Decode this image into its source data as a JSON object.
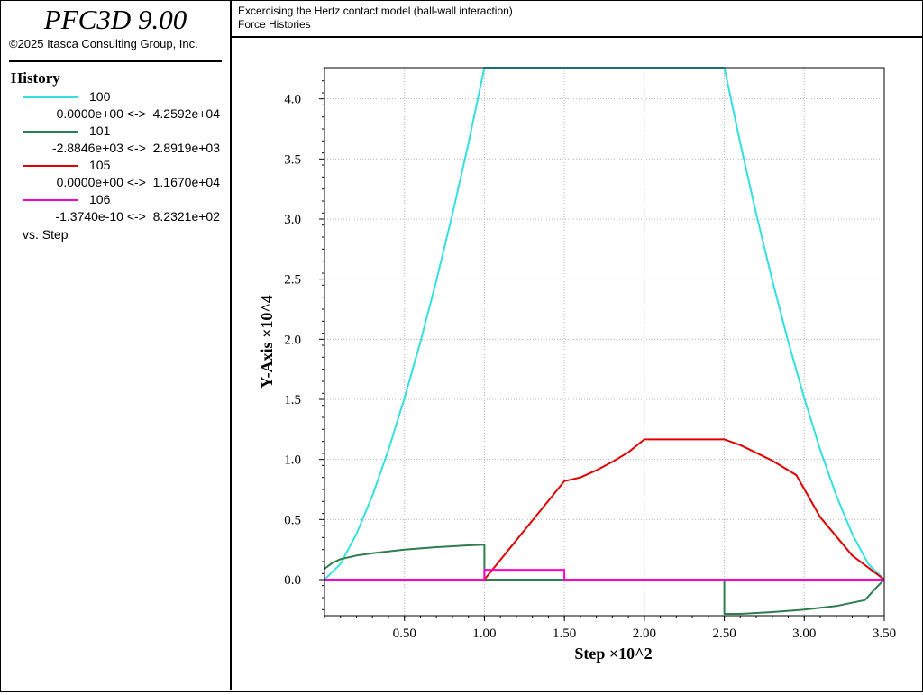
{
  "app": {
    "title": "PFC3D 9.00",
    "copyright": "©2025 Itasca Consulting Group, Inc."
  },
  "header": {
    "line1": "Excercising the Hertz contact model (ball-wall interaction)",
    "line2": "Force Histories"
  },
  "legend": {
    "heading": "History",
    "entries": [
      {
        "id": "100",
        "range": "0.0000e+00 <->  4.2592e+04",
        "color": "#33e0e0"
      },
      {
        "id": "101",
        "range": "-2.8846e+03 <->  2.8919e+03",
        "color": "#2e7d4f"
      },
      {
        "id": "105",
        "range": "0.0000e+00 <->  1.1670e+04",
        "color": "#e00000"
      },
      {
        "id": "106",
        "range": "-1.3740e-10 <->  8.2321e+02",
        "color": "#ff00c8"
      }
    ],
    "vs": "vs. Step"
  },
  "chart_data": {
    "type": "line",
    "xlabel": "Step  ×10^2",
    "ylabel": "Y-Axis  ×10^4",
    "xlim": [
      0,
      3.5
    ],
    "ylim": [
      -0.3,
      4.26
    ],
    "x_ticks": [
      "0.50",
      "1.00",
      "1.50",
      "2.00",
      "2.50",
      "3.00",
      "3.50"
    ],
    "y_ticks": [
      "0.0",
      "0.5",
      "1.0",
      "1.5",
      "2.0",
      "2.5",
      "3.0",
      "3.5",
      "4.0"
    ],
    "grid": true,
    "series": [
      {
        "name": "100",
        "color": "#33e0e0",
        "x": [
          0,
          0.1,
          0.2,
          0.3,
          0.4,
          0.5,
          0.6,
          0.7,
          0.8,
          0.9,
          1.0,
          1.5,
          2.0,
          2.5,
          2.6,
          2.7,
          2.8,
          2.9,
          3.0,
          3.1,
          3.2,
          3.3,
          3.4,
          3.5
        ],
        "y": [
          0,
          0.13,
          0.38,
          0.7,
          1.08,
          1.51,
          1.98,
          2.49,
          3.04,
          3.63,
          4.26,
          4.26,
          4.26,
          4.26,
          3.63,
          3.04,
          2.49,
          1.98,
          1.51,
          1.08,
          0.7,
          0.38,
          0.13,
          0
        ]
      },
      {
        "name": "101",
        "color": "#2e7d4f",
        "x": [
          0,
          0.05,
          0.1,
          0.2,
          0.3,
          0.5,
          0.7,
          0.9,
          1.0,
          1.0,
          1.5,
          1.5,
          2.5,
          2.5,
          2.6,
          2.8,
          3.0,
          3.2,
          3.38,
          3.44,
          3.5
        ],
        "y": [
          0.09,
          0.14,
          0.17,
          0.2,
          0.22,
          0.25,
          0.27,
          0.285,
          0.29,
          0,
          0,
          0,
          0,
          -0.285,
          -0.285,
          -0.27,
          -0.25,
          -0.22,
          -0.17,
          -0.08,
          0
        ]
      },
      {
        "name": "105",
        "color": "#e00000",
        "x": [
          0,
          1.0,
          1.5,
          1.6,
          1.7,
          1.8,
          1.9,
          2.0,
          2.5,
          2.6,
          2.8,
          2.95,
          3.1,
          3.3,
          3.5
        ],
        "y": [
          0,
          0,
          0.82,
          0.85,
          0.91,
          0.98,
          1.06,
          1.167,
          1.167,
          1.12,
          0.99,
          0.87,
          0.52,
          0.2,
          0
        ]
      },
      {
        "name": "106",
        "color": "#ff00c8",
        "x": [
          0,
          1.0,
          1.0,
          1.5,
          1.5,
          3.5
        ],
        "y": [
          0,
          0,
          0.082,
          0.082,
          0,
          0
        ]
      }
    ]
  }
}
